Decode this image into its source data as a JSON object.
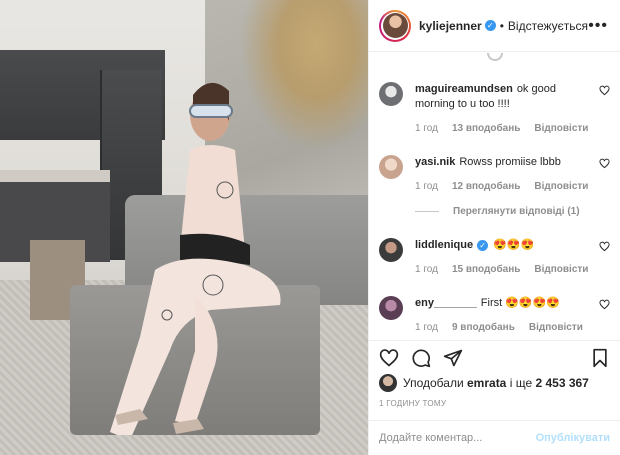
{
  "post": {
    "author": "kyliejenner",
    "follow_label": "Відстежується"
  },
  "comments": [
    {
      "user": "maguireamundsen",
      "text": "ok good morning to u too !!!!",
      "time": "1 год",
      "likes": "13 вподобань",
      "reply": "Відповісти",
      "avatar_color": "#6d6f73"
    },
    {
      "user": "yasi.nik",
      "text": "Rowss promiise lbbb",
      "time": "1 год",
      "likes": "12 вподобань",
      "reply": "Відповісти",
      "avatar_color": "#c8a48f",
      "view_replies": "Переглянути відповіді (1)"
    },
    {
      "user": "liddlenique",
      "text": "😍😍😍",
      "time": "1 год",
      "likes": "15 вподобань",
      "reply": "Відповісти",
      "avatar_color": "#3b3b3b",
      "verified": true
    },
    {
      "user": "eny_______",
      "text": "First 😍😍😍😍",
      "time": "1 год",
      "likes": "9 вподобань",
      "reply": "Відповісти",
      "avatar_color": "#5a3e54"
    }
  ],
  "likes_line": {
    "prefix": "Уподобали",
    "user": "emrata",
    "connector": "і ще",
    "count": "2 453 367"
  },
  "timestamp": "1 ГОДИНУ ТОМУ",
  "add_comment": {
    "placeholder": "Додайте коментар...",
    "publish_label": "Опублікувати"
  },
  "colors": {
    "accent_blue": "#3897f0",
    "publish_disabled": "#b2dffc",
    "muted_text": "#8e8e8e"
  }
}
